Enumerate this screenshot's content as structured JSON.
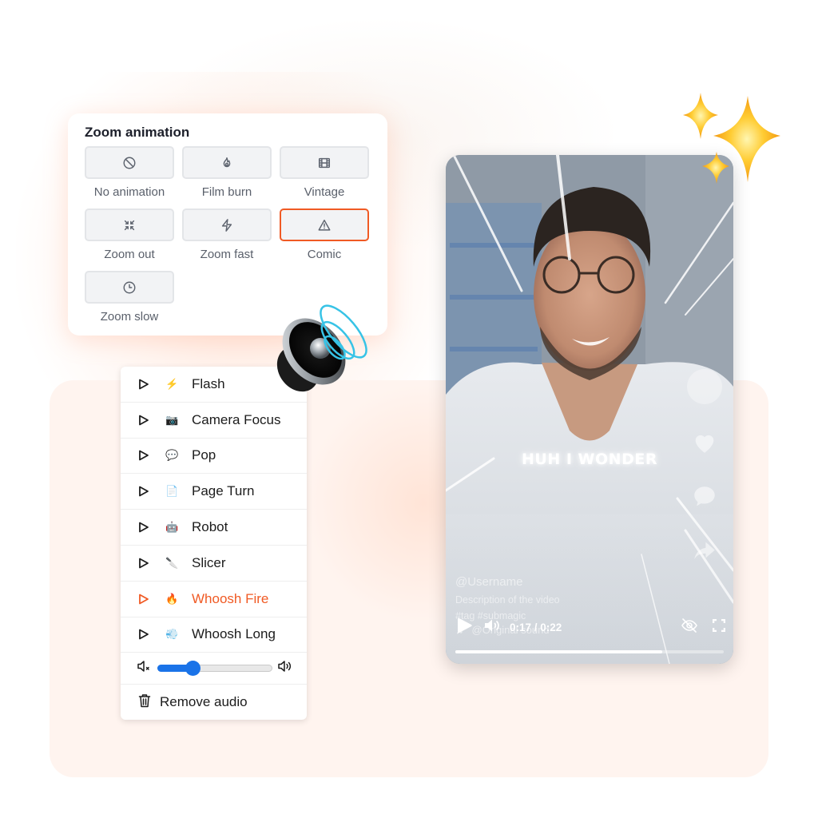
{
  "zoom_animation": {
    "title": "Zoom animation",
    "options": [
      {
        "label": "No animation",
        "icon": "ban-icon",
        "selected": false
      },
      {
        "label": "Film burn",
        "icon": "flame-icon",
        "selected": false
      },
      {
        "label": "Vintage",
        "icon": "film-icon",
        "selected": false
      },
      {
        "label": "Zoom out",
        "icon": "shrink-icon",
        "selected": false
      },
      {
        "label": "Zoom fast",
        "icon": "lightning-icon",
        "selected": false
      },
      {
        "label": "Comic",
        "icon": "warning-triangle-icon",
        "selected": true
      },
      {
        "label": "Zoom slow",
        "icon": "clock-icon",
        "selected": false
      }
    ],
    "accent_color": "#f05a24"
  },
  "sound_effects": {
    "items": [
      {
        "label": "Flash",
        "emoji": "⚡",
        "active": false
      },
      {
        "label": "Camera Focus",
        "emoji": "📷",
        "active": false
      },
      {
        "label": "Pop",
        "emoji": "💬",
        "active": false
      },
      {
        "label": "Page Turn",
        "emoji": "📄",
        "active": false
      },
      {
        "label": "Robot",
        "emoji": "🤖",
        "active": false
      },
      {
        "label": "Slicer",
        "emoji": "🔪",
        "active": false
      },
      {
        "label": "Whoosh Fire",
        "emoji": "🔥",
        "active": true
      },
      {
        "label": "Whoosh Long",
        "emoji": "💨",
        "active": false
      }
    ],
    "volume_percent": 30,
    "remove_label": "Remove audio",
    "slider_color": "#1a73e8"
  },
  "video_player": {
    "caption": "HUH I WONDER",
    "username": "@Username",
    "description": "Description of the video",
    "tags": "#tag #submagic",
    "sound": "@Original sound",
    "current_time": "0:17",
    "duration": "0:22",
    "time_display": "0:17 / 0:22",
    "progress_percent": 77
  }
}
